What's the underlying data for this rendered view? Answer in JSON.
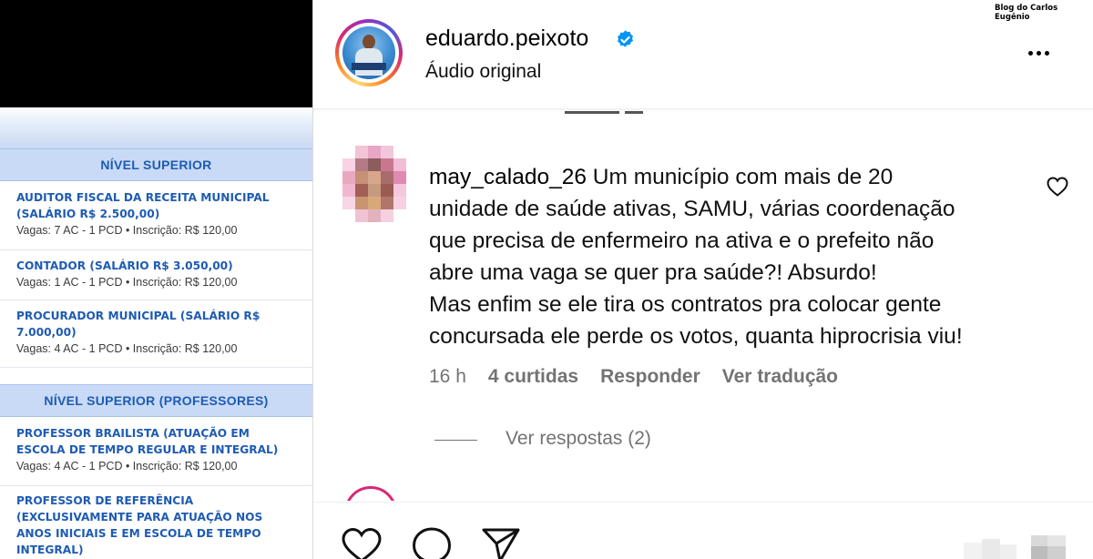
{
  "left_panel": {
    "sections": [
      {
        "title": "NÍVEL SUPERIOR",
        "jobs": [
          {
            "title": "AUDITOR FISCAL DA RECEITA MUNICIPAL (SALÁRIO R$ 2.500,00)",
            "meta": "Vagas: 7 AC - 1 PCD • Inscrição: R$ 120,00"
          },
          {
            "title": "CONTADOR (SALÁRIO R$ 3.050,00)",
            "meta": "Vagas: 1 AC - 1 PCD • Inscrição: R$ 120,00"
          },
          {
            "title": "PROCURADOR MUNICIPAL (SALÁRIO R$ 7.000,00)",
            "meta": "Vagas: 4 AC - 1 PCD • Inscrição: R$ 120,00"
          }
        ]
      },
      {
        "title": "NÍVEL SUPERIOR (PROFESSORES)",
        "jobs": [
          {
            "title": "PROFESSOR BRAILISTA (ATUAÇÃO EM ESCOLA DE TEMPO REGULAR E INTEGRAL)",
            "meta": "Vagas: 4 AC - 1 PCD • Inscrição: R$ 120,00"
          },
          {
            "title": "PROFESSOR DE REFERÊNCIA (EXCLUSIVAMENTE PARA ATUAÇÃO NOS ANOS INICIAIS E EM ESCOLA DE TEMPO INTEGRAL)",
            "meta": ""
          }
        ]
      }
    ]
  },
  "post": {
    "username": "eduardo.peixoto",
    "subtitle": "Áudio original",
    "watermark": "Blog do Carlos Eugênio"
  },
  "comment": {
    "username": "may_calado_26",
    "text": "Um município com mais de 20 unidade de saúde ativas, SAMU, várias coordenação que precisa de enfermeiro na ativa e o prefeito não abre uma vaga se quer pra saúde?! Absurdo! Mas enfim se ele tira os contratos pra colocar gente concursada ele perde os votos, quanta hiprocrisia viu!",
    "line1": "Um município com mais de 20",
    "line2": "unidade de saúde ativas, SAMU, várias coordenação",
    "line3": "que precisa de enfermeiro na ativa e o prefeito não",
    "line4": "abre uma vaga se quer pra saúde?! Absurdo!",
    "line5": "Mas enfim se ele tira os contratos pra colocar gente",
    "line6": "concursada ele perde os votos, quanta hiprocrisia viu!",
    "time": "16 h",
    "likes": "4 curtidas",
    "reply": "Responder",
    "translate": "Ver tradução",
    "view_replies": "Ver respostas (2)"
  },
  "icons": {
    "verified": "verified-badge-icon",
    "more": "more-options-icon",
    "like": "heart-icon",
    "comment": "comment-icon",
    "share": "send-icon"
  },
  "colors": {
    "link_blue": "#1e5bb3",
    "section_bg": "#c8daf6",
    "meta_gray": "#737373",
    "verified_blue": "#0095f6"
  }
}
